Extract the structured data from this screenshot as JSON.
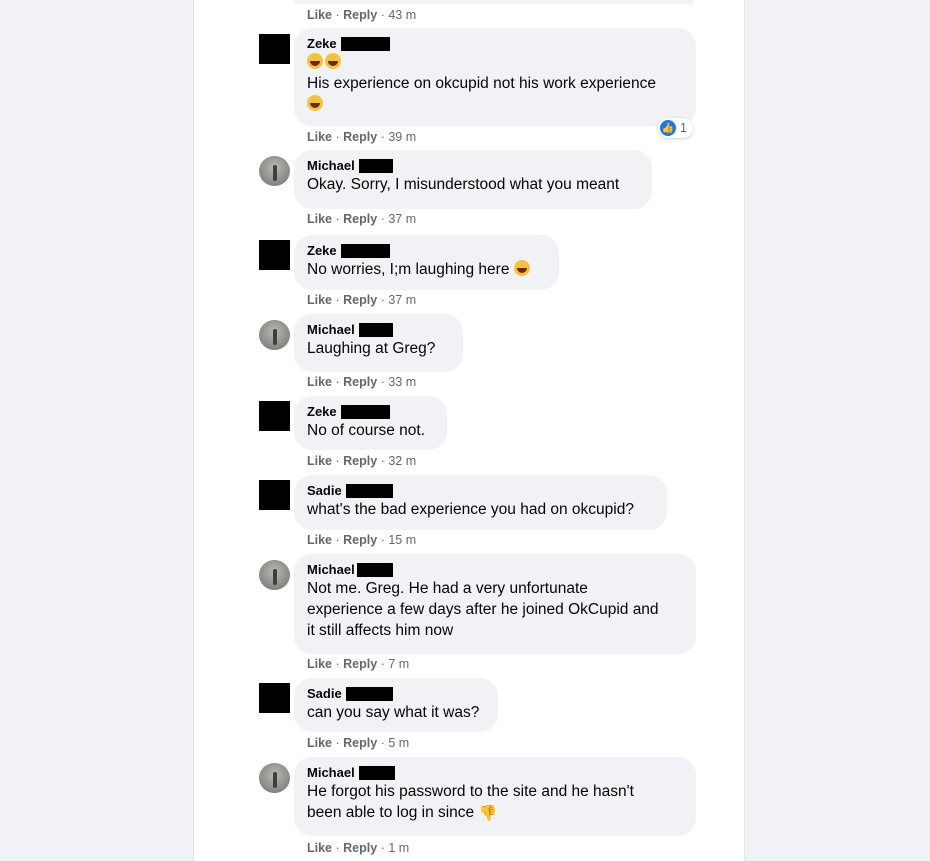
{
  "comments": [
    {
      "author": "Zeke",
      "avatar": "blocked",
      "text": "His experience on okcupid not his work experience",
      "time": "39 m",
      "reaction_count": "1"
    },
    {
      "author": "Michael",
      "avatar": "photo",
      "text": "Okay. Sorry, I misunderstood what you meant",
      "time": "37 m"
    },
    {
      "author": "Zeke",
      "avatar": "blocked",
      "text": "No worries, I;m laughing here",
      "time": "37 m"
    },
    {
      "author": "Michael",
      "avatar": "photo",
      "text": "Laughing at Greg?",
      "time": "33 m"
    },
    {
      "author": "Zeke",
      "avatar": "blocked",
      "text": "No of course not.",
      "time": "32 m"
    },
    {
      "author": "Sadie",
      "avatar": "blocked",
      "text": "what's the bad experience you had on okcupid?",
      "time": "15 m"
    },
    {
      "author": "Michael",
      "avatar": "photo",
      "text_lines": [
        "Not me. Greg. He had a very unfortunate",
        "experience a few days after he joined OkCupid and",
        "it still affects him now"
      ],
      "time": "7 m"
    },
    {
      "author": "Sadie",
      "avatar": "blocked",
      "text": "can you say what it was?",
      "time": "5 m"
    },
    {
      "author": "Michael",
      "avatar": "photo",
      "text_lines": [
        "He forgot his password to the site and he hasn't",
        "been able to log in since"
      ],
      "time": "1 m"
    }
  ],
  "previous": {
    "time": "43 m"
  },
  "labels": {
    "like": "Like",
    "reply": "Reply",
    "sep": "·"
  },
  "icons": {
    "laugh": "laughing-emoji-icon",
    "thumbs_down": "thumbs-down-icon",
    "like": "like-reaction-icon"
  },
  "colors": {
    "bubble": "#f0f2f5",
    "meta": "#65676b",
    "like_blue": "#1877f2"
  }
}
